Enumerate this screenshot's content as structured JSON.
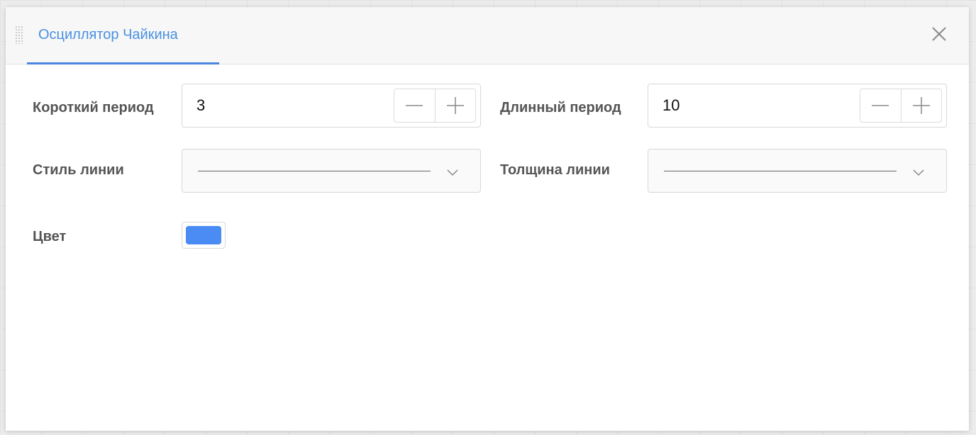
{
  "dialog": {
    "title": "Осциллятор Чайкина"
  },
  "fields": {
    "short_period": {
      "label": "Короткий период",
      "value": "3"
    },
    "long_period": {
      "label": "Длинный период",
      "value": "10"
    },
    "line_style": {
      "label": "Стиль линии",
      "value": "solid"
    },
    "line_width": {
      "label": "Толщина линии",
      "value": "thin"
    },
    "color": {
      "label": "Цвет",
      "value": "#4a8cf4"
    }
  },
  "icons": {
    "close": "close-icon",
    "drag": "drag-handle-icon",
    "minus": "minus-icon",
    "plus": "plus-icon",
    "chevron": "chevron-down-icon"
  },
  "colors": {
    "accent": "#4a90e2",
    "tab_underline": "#4a86e0",
    "label": "#555555"
  }
}
